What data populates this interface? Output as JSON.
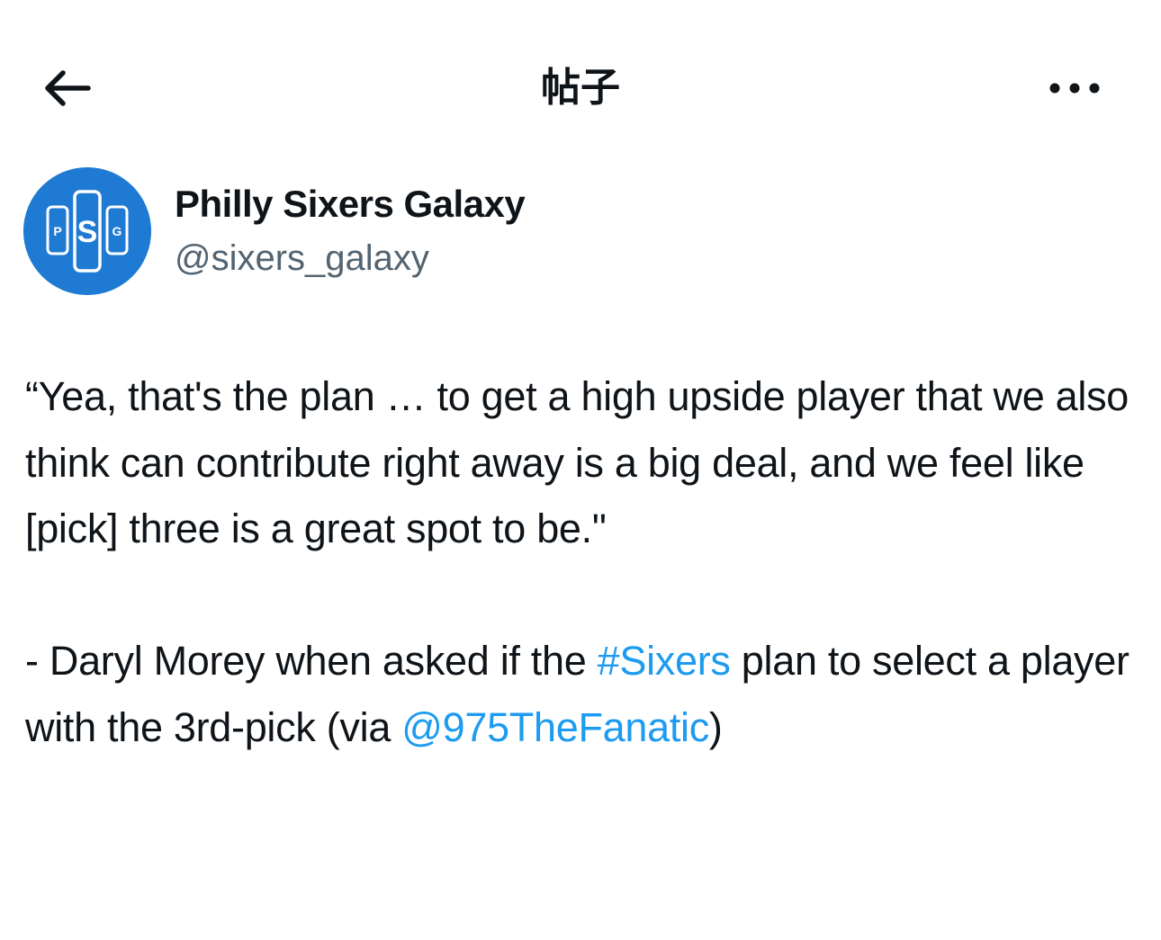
{
  "header": {
    "title": "帖子",
    "back_icon": "arrow-left-icon",
    "more_icon": "more-horizontal-icon"
  },
  "author": {
    "display_name": "Philly Sixers Galaxy",
    "handle": "@sixers_galaxy",
    "avatar_letters": [
      "P",
      "S",
      "G"
    ],
    "avatar_color": "#1f7ad3"
  },
  "post": {
    "quote": "“Yea, that's the plan … to get a high upside player that we also think can contribute right away is a big deal, and we feel like [pick] three is a great spot to be.\"",
    "attribution_prefix": "- Daryl Morey when asked if the ",
    "hashtag": "#Sixers",
    "attribution_middle": " plan to select a player with the 3rd-pick (via ",
    "mention": "@975TheFanatic",
    "attribution_suffix": ")"
  },
  "colors": {
    "text": "#0f1419",
    "secondary": "#536471",
    "link": "#1d9bf0"
  }
}
